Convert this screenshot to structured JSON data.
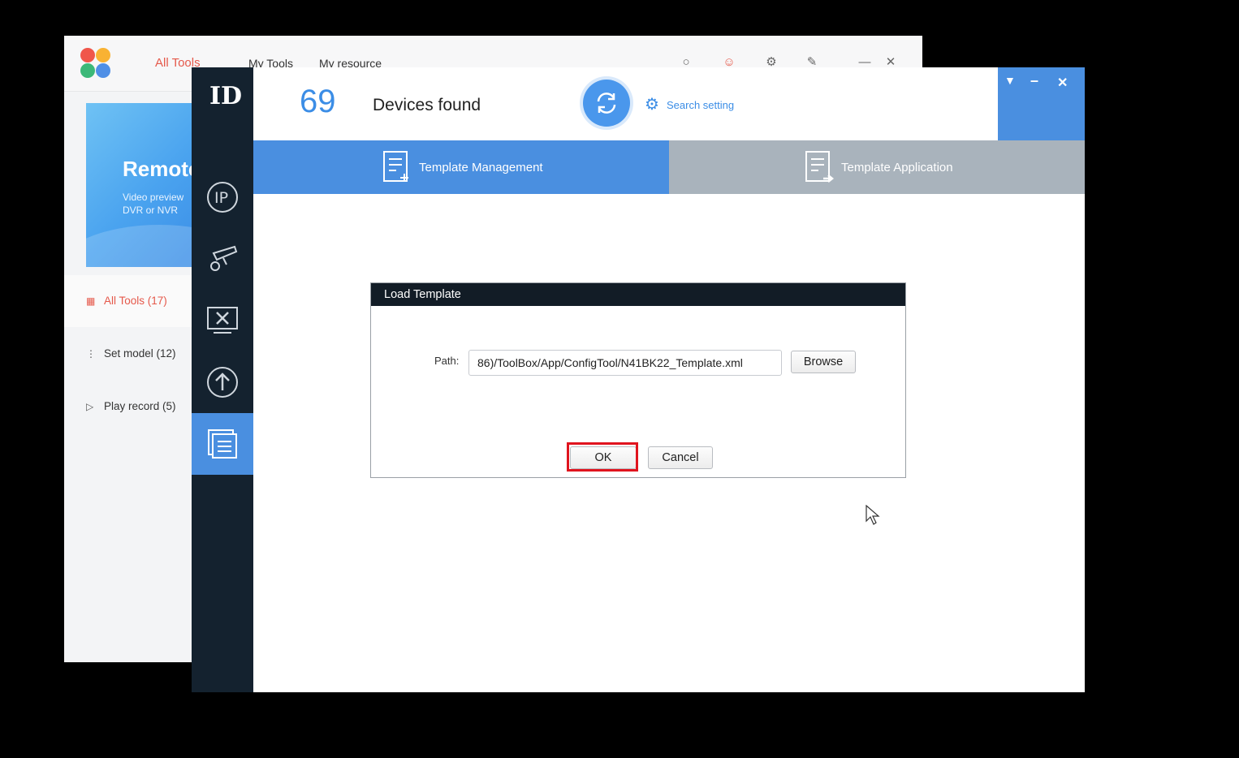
{
  "background_window": {
    "tabs": [
      "All Tools",
      "My Tools",
      "My resource"
    ],
    "banner": {
      "title": "Remote",
      "description": "Video preview DVR or NVR"
    },
    "sidebar": [
      {
        "label": "All Tools (17)",
        "icon": "grid-icon"
      },
      {
        "label": "Set model (12)",
        "icon": "sliders-icon"
      },
      {
        "label": "Play record (5)",
        "icon": "play-icon"
      }
    ]
  },
  "main_window": {
    "logo": "ID",
    "header": {
      "device_count": "69",
      "device_label": "Devices found",
      "search_setting": "Search setting"
    },
    "tabs": [
      {
        "label": "Template Management",
        "active": true
      },
      {
        "label": "Template Application",
        "active": false
      }
    ]
  },
  "dialog": {
    "title": "Load Template",
    "path_label": "Path:",
    "path_value": "86)/ToolBox/App/ConfigTool/N41BK22_Template.xml",
    "browse_label": "Browse",
    "ok_label": "OK",
    "cancel_label": "Cancel",
    "highlight_color": "#e0141e"
  },
  "colors": {
    "accent": "#4a8fe0",
    "sidebar": "#14222f",
    "inactive_tab": "#a9b3bc"
  }
}
